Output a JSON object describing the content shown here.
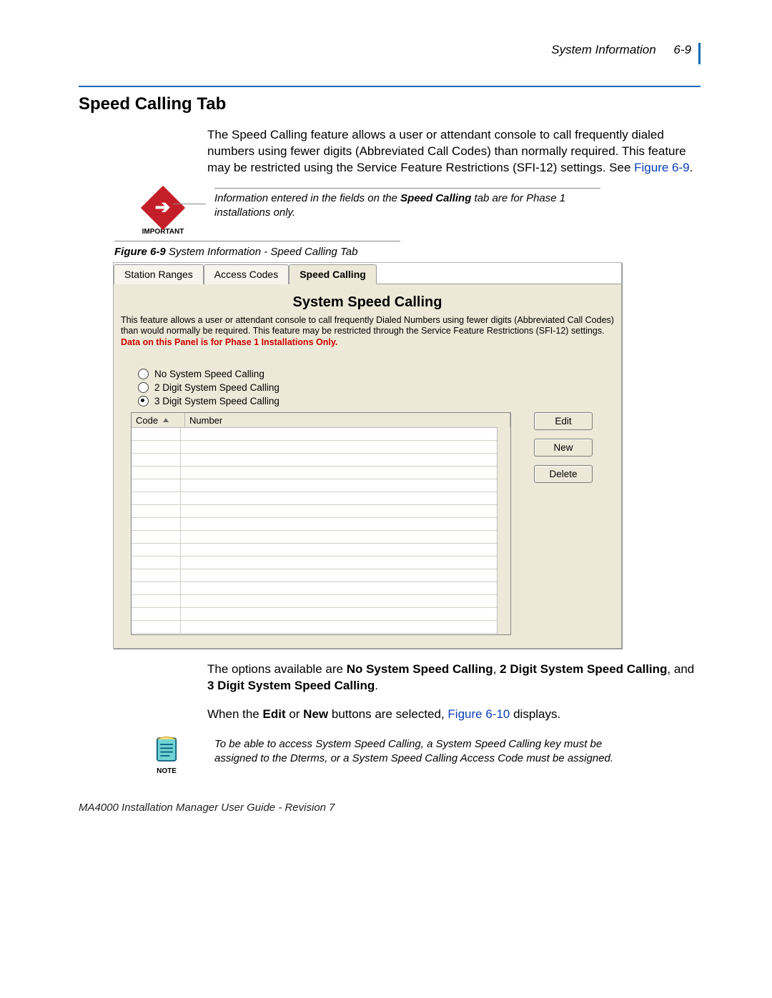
{
  "header": {
    "section": "System Information",
    "page": "6-9"
  },
  "title": "Speed Calling Tab",
  "intro": {
    "text": "The Speed Calling feature allows a user or attendant console to call frequently dialed numbers using fewer digits (Abbreviated Call Codes) than normally required. This feature may be restricted using the Service Feature Restrictions (SFI-12) settings. See ",
    "link": "Figure 6-9",
    "after": "."
  },
  "important": {
    "label": "IMPORTANT",
    "text_before": "Information entered in the fields on the ",
    "bold": "Speed Calling",
    "text_after": " tab are for Phase 1 installations only."
  },
  "figure_caption": {
    "bold": "Figure 6-9",
    "rest": "  System Information - Speed Calling Tab"
  },
  "panel": {
    "tabs": [
      "Station Ranges",
      "Access Codes",
      "Speed Calling"
    ],
    "active_tab": 2,
    "title": "System Speed Calling",
    "description": "This feature allows a user or attendant console to call frequently Dialed Numbers using fewer digits (Abbreviated Call Codes) than would normally be required.  This feature may be restricted through the Service Feature Restrictions (SFI-12) settings.",
    "warning": "Data on this Panel is for Phase 1 Installations Only.",
    "radios": [
      "No System Speed Calling",
      "2 Digit System Speed Calling",
      "3 Digit System Speed Calling"
    ],
    "selected_radio": 2,
    "columns": [
      "Code",
      "Number"
    ],
    "buttons": {
      "edit": "Edit",
      "new": "New",
      "delete": "Delete"
    }
  },
  "after1": {
    "t1": "The options available are ",
    "b1": "No System Speed Calling",
    "t2": ", ",
    "b2": "2 Digit System Speed Calling",
    "t3": ", and ",
    "b3": "3 Digit System Speed Calling",
    "t4": "."
  },
  "after2": {
    "t1": "When the ",
    "b1": "Edit",
    "t2": " or ",
    "b2": "New",
    "t3": " buttons are selected, ",
    "link": "Figure 6-10",
    "t4": " displays."
  },
  "note": {
    "label": "NOTE",
    "text": "To be able to access System Speed Calling, a System Speed Calling key must be assigned to the Dterms, or a System Speed Calling Access Code must be assigned."
  },
  "footer": "MA4000 Installation Manager User Guide - Revision 7"
}
